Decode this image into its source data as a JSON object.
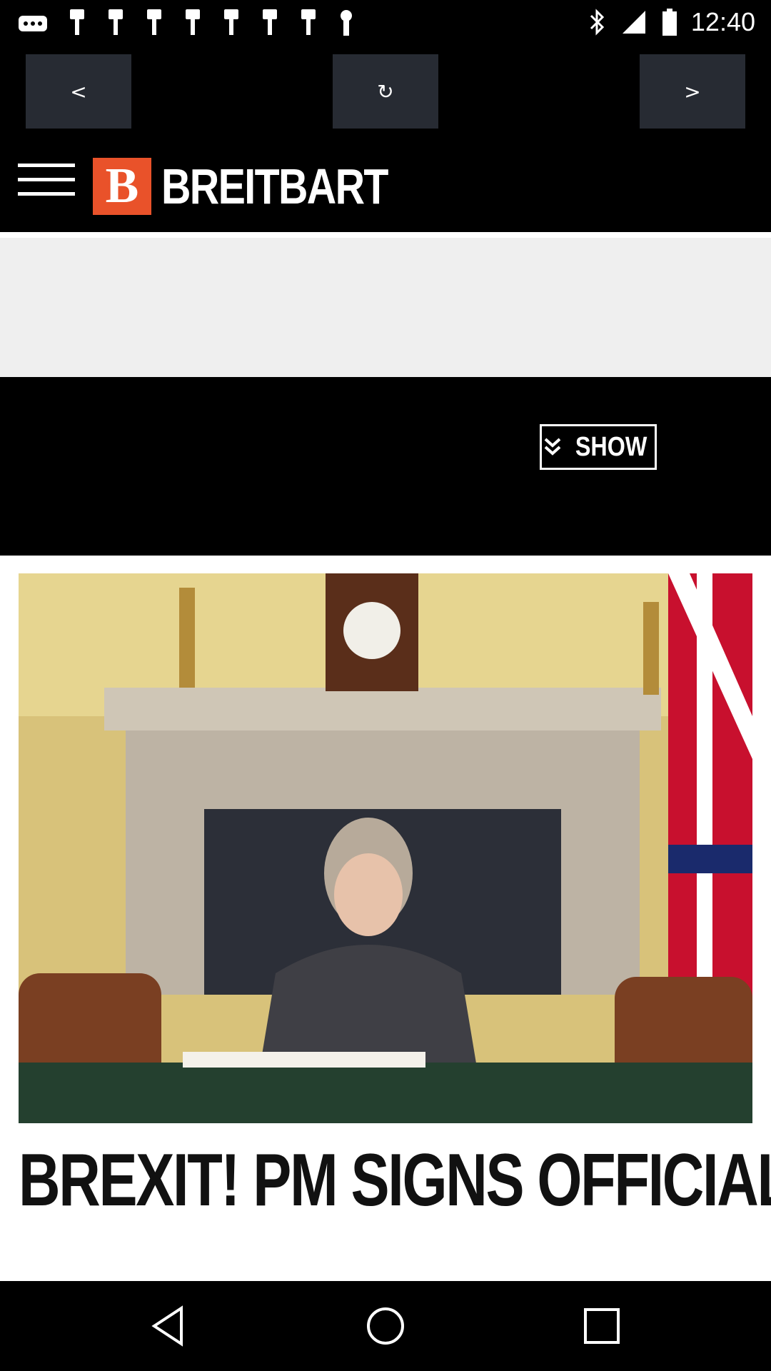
{
  "status_bar": {
    "time": "12:40",
    "icons": [
      "more-icon",
      "notification-icon",
      "bluetooth-icon",
      "signal-icon",
      "battery-icon"
    ]
  },
  "browser_nav": {
    "back_label": "<",
    "refresh_label": "↻",
    "forward_label": ">"
  },
  "site": {
    "logo_letter": "B",
    "name": "BREITBART",
    "brand_color": "#e9522a"
  },
  "banner": {
    "show_label": "SHOW"
  },
  "article": {
    "headline": "BREXIT! PM SIGNS OFFICIAL LETTER TO BRUSSELS"
  },
  "system_nav": {
    "icons": [
      "back-icon",
      "home-icon",
      "recents-icon"
    ]
  }
}
